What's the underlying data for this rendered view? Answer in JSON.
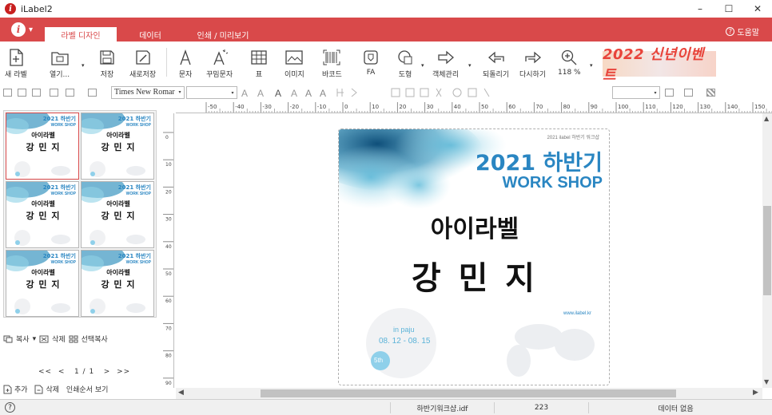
{
  "window": {
    "title": "iLabel2",
    "minimize": "–",
    "maximize": "☐",
    "close": "✕"
  },
  "ribbon": {
    "menu_caret": "▾",
    "tabs": [
      {
        "label": "라벨 디자인",
        "active": true
      },
      {
        "label": "데이터"
      },
      {
        "label": "인쇄 / 미리보기"
      }
    ],
    "help_label": "도움말",
    "colors": {
      "ribbon": "#d9494a",
      "accent": "#e8443b"
    }
  },
  "toolbar": {
    "items": [
      {
        "label": "새 라벨",
        "icon": "new-label-icon"
      },
      {
        "label": "열기...",
        "icon": "open-icon"
      },
      {
        "label": "저장",
        "icon": "save-icon"
      },
      {
        "label": "새로저장",
        "icon": "save-as-icon"
      },
      {
        "label": "문자",
        "icon": "text-icon"
      },
      {
        "label": "꾸밈문자",
        "icon": "decorated-text-icon"
      },
      {
        "label": "표",
        "icon": "table-icon"
      },
      {
        "label": "이미지",
        "icon": "image-icon"
      },
      {
        "label": "바코드",
        "icon": "barcode-icon"
      },
      {
        "label": "FA",
        "icon": "fa-icon"
      },
      {
        "label": "도형",
        "icon": "shape-icon"
      },
      {
        "label": "객체관리",
        "icon": "object-manage-icon"
      },
      {
        "label": "되돌리기",
        "icon": "undo-icon"
      },
      {
        "label": "다시하기",
        "icon": "redo-icon"
      },
      {
        "label": "118 %",
        "icon": "zoom-icon"
      }
    ],
    "banner": "2022 신년이벤트"
  },
  "format_bar": {
    "font": "Times New Romar",
    "font_size": "",
    "dropdown": "▾"
  },
  "ruler": {
    "h_ticks": [
      "-50",
      "-40",
      "-30",
      "-20",
      "-10",
      "0",
      "10",
      "20",
      "30",
      "40",
      "50",
      "60",
      "70",
      "80",
      "90",
      "100",
      "110",
      "120",
      "130",
      "140",
      "150"
    ],
    "v_ticks": [
      "0",
      "10",
      "20",
      "30",
      "40",
      "50",
      "60",
      "70",
      "80",
      "90"
    ]
  },
  "label": {
    "tag": "2021 ilabel 하반기 워크샵",
    "headline": "2021 하반기",
    "subhead": "WORK SHOP",
    "brand": "아이라벨",
    "name": "강 민 지",
    "url": "www.ilabel.kr",
    "place": "in paju",
    "dates": "08. 12 - 08. 15",
    "edition": "5th"
  },
  "thumbnails": {
    "count": 6,
    "headline": "2021 하반기",
    "subhead": "WORK SHOP",
    "brand": "아이라벨",
    "name": "강 민 지"
  },
  "panel": {
    "copy": "복사",
    "delete": "삭제",
    "select_copy": "선택복사",
    "copy_caret": "▾",
    "pager": {
      "first": "<<",
      "prev": "<",
      "page": "1 / 1",
      "next": ">",
      "last": ">>"
    },
    "add": "추가",
    "remove": "삭제",
    "print_order": "인쇄순서 보기"
  },
  "status": {
    "filename": "하반기워크샵.idf",
    "count": "223",
    "data_state": "데이터 없음",
    "help_symbol": "?"
  }
}
